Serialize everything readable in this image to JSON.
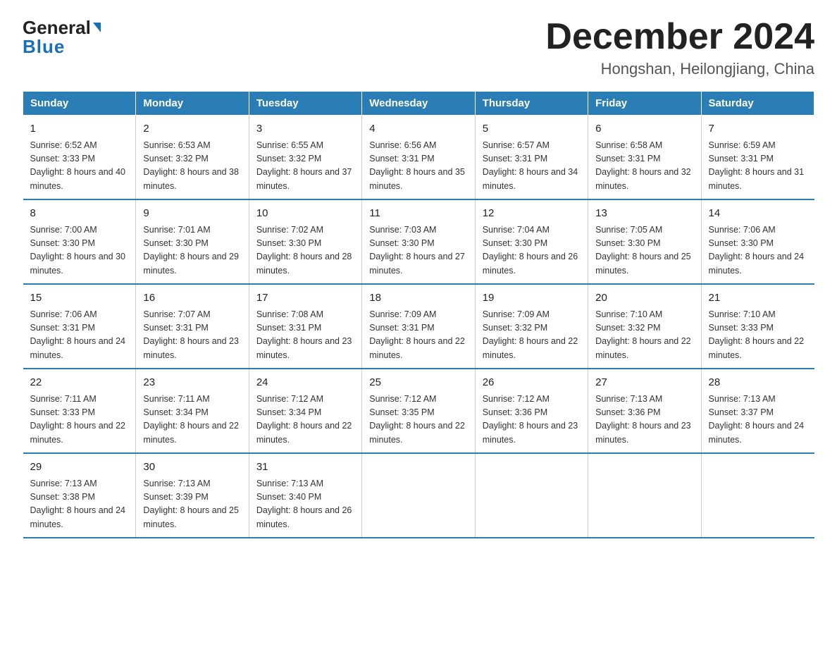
{
  "header": {
    "logo_general": "General",
    "logo_blue": "Blue",
    "title": "December 2024",
    "subtitle": "Hongshan, Heilongjiang, China"
  },
  "days_of_week": [
    "Sunday",
    "Monday",
    "Tuesday",
    "Wednesday",
    "Thursday",
    "Friday",
    "Saturday"
  ],
  "weeks": [
    [
      {
        "day": "1",
        "sunrise": "6:52 AM",
        "sunset": "3:33 PM",
        "daylight": "8 hours and 40 minutes."
      },
      {
        "day": "2",
        "sunrise": "6:53 AM",
        "sunset": "3:32 PM",
        "daylight": "8 hours and 38 minutes."
      },
      {
        "day": "3",
        "sunrise": "6:55 AM",
        "sunset": "3:32 PM",
        "daylight": "8 hours and 37 minutes."
      },
      {
        "day": "4",
        "sunrise": "6:56 AM",
        "sunset": "3:31 PM",
        "daylight": "8 hours and 35 minutes."
      },
      {
        "day": "5",
        "sunrise": "6:57 AM",
        "sunset": "3:31 PM",
        "daylight": "8 hours and 34 minutes."
      },
      {
        "day": "6",
        "sunrise": "6:58 AM",
        "sunset": "3:31 PM",
        "daylight": "8 hours and 32 minutes."
      },
      {
        "day": "7",
        "sunrise": "6:59 AM",
        "sunset": "3:31 PM",
        "daylight": "8 hours and 31 minutes."
      }
    ],
    [
      {
        "day": "8",
        "sunrise": "7:00 AM",
        "sunset": "3:30 PM",
        "daylight": "8 hours and 30 minutes."
      },
      {
        "day": "9",
        "sunrise": "7:01 AM",
        "sunset": "3:30 PM",
        "daylight": "8 hours and 29 minutes."
      },
      {
        "day": "10",
        "sunrise": "7:02 AM",
        "sunset": "3:30 PM",
        "daylight": "8 hours and 28 minutes."
      },
      {
        "day": "11",
        "sunrise": "7:03 AM",
        "sunset": "3:30 PM",
        "daylight": "8 hours and 27 minutes."
      },
      {
        "day": "12",
        "sunrise": "7:04 AM",
        "sunset": "3:30 PM",
        "daylight": "8 hours and 26 minutes."
      },
      {
        "day": "13",
        "sunrise": "7:05 AM",
        "sunset": "3:30 PM",
        "daylight": "8 hours and 25 minutes."
      },
      {
        "day": "14",
        "sunrise": "7:06 AM",
        "sunset": "3:30 PM",
        "daylight": "8 hours and 24 minutes."
      }
    ],
    [
      {
        "day": "15",
        "sunrise": "7:06 AM",
        "sunset": "3:31 PM",
        "daylight": "8 hours and 24 minutes."
      },
      {
        "day": "16",
        "sunrise": "7:07 AM",
        "sunset": "3:31 PM",
        "daylight": "8 hours and 23 minutes."
      },
      {
        "day": "17",
        "sunrise": "7:08 AM",
        "sunset": "3:31 PM",
        "daylight": "8 hours and 23 minutes."
      },
      {
        "day": "18",
        "sunrise": "7:09 AM",
        "sunset": "3:31 PM",
        "daylight": "8 hours and 22 minutes."
      },
      {
        "day": "19",
        "sunrise": "7:09 AM",
        "sunset": "3:32 PM",
        "daylight": "8 hours and 22 minutes."
      },
      {
        "day": "20",
        "sunrise": "7:10 AM",
        "sunset": "3:32 PM",
        "daylight": "8 hours and 22 minutes."
      },
      {
        "day": "21",
        "sunrise": "7:10 AM",
        "sunset": "3:33 PM",
        "daylight": "8 hours and 22 minutes."
      }
    ],
    [
      {
        "day": "22",
        "sunrise": "7:11 AM",
        "sunset": "3:33 PM",
        "daylight": "8 hours and 22 minutes."
      },
      {
        "day": "23",
        "sunrise": "7:11 AM",
        "sunset": "3:34 PM",
        "daylight": "8 hours and 22 minutes."
      },
      {
        "day": "24",
        "sunrise": "7:12 AM",
        "sunset": "3:34 PM",
        "daylight": "8 hours and 22 minutes."
      },
      {
        "day": "25",
        "sunrise": "7:12 AM",
        "sunset": "3:35 PM",
        "daylight": "8 hours and 22 minutes."
      },
      {
        "day": "26",
        "sunrise": "7:12 AM",
        "sunset": "3:36 PM",
        "daylight": "8 hours and 23 minutes."
      },
      {
        "day": "27",
        "sunrise": "7:13 AM",
        "sunset": "3:36 PM",
        "daylight": "8 hours and 23 minutes."
      },
      {
        "day": "28",
        "sunrise": "7:13 AM",
        "sunset": "3:37 PM",
        "daylight": "8 hours and 24 minutes."
      }
    ],
    [
      {
        "day": "29",
        "sunrise": "7:13 AM",
        "sunset": "3:38 PM",
        "daylight": "8 hours and 24 minutes."
      },
      {
        "day": "30",
        "sunrise": "7:13 AM",
        "sunset": "3:39 PM",
        "daylight": "8 hours and 25 minutes."
      },
      {
        "day": "31",
        "sunrise": "7:13 AM",
        "sunset": "3:40 PM",
        "daylight": "8 hours and 26 minutes."
      },
      null,
      null,
      null,
      null
    ]
  ]
}
